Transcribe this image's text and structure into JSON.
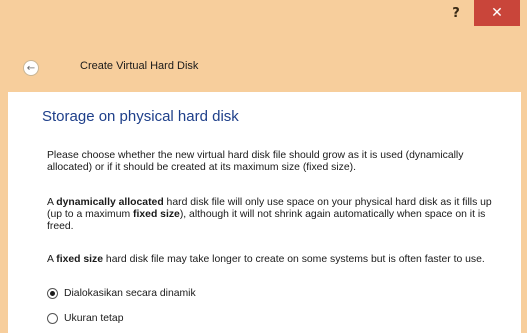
{
  "titlebar": {
    "help_label": "?",
    "close_label": "✕"
  },
  "header": {
    "back_icon": "←",
    "title": "Create Virtual Hard Disk"
  },
  "main": {
    "section_title": "Storage on physical hard disk",
    "para1": "Please choose whether the new virtual hard disk file should grow as it is used (dynamically allocated) or if it should be created at its maximum size (fixed size).",
    "para2": {
      "prefix": "A ",
      "bold1": "dynamically allocated",
      "mid": " hard disk file will only use space on your physical hard disk as it fills up (up to a maximum ",
      "bold2": "fixed size",
      "suffix": "), although it will not shrink again automatically when space on it is freed."
    },
    "para3": {
      "prefix": "A ",
      "bold1": "fixed size",
      "suffix": " hard disk file may take longer to create on some systems but is often faster to use."
    },
    "options": [
      {
        "label": "Dialokasikan secara dinamik",
        "selected": true
      },
      {
        "label": "Ukuran tetap",
        "selected": false
      }
    ]
  },
  "colors": {
    "frame": "#f7ce9c",
    "close": "#c9453a",
    "title_text": "#1e3f8a"
  }
}
